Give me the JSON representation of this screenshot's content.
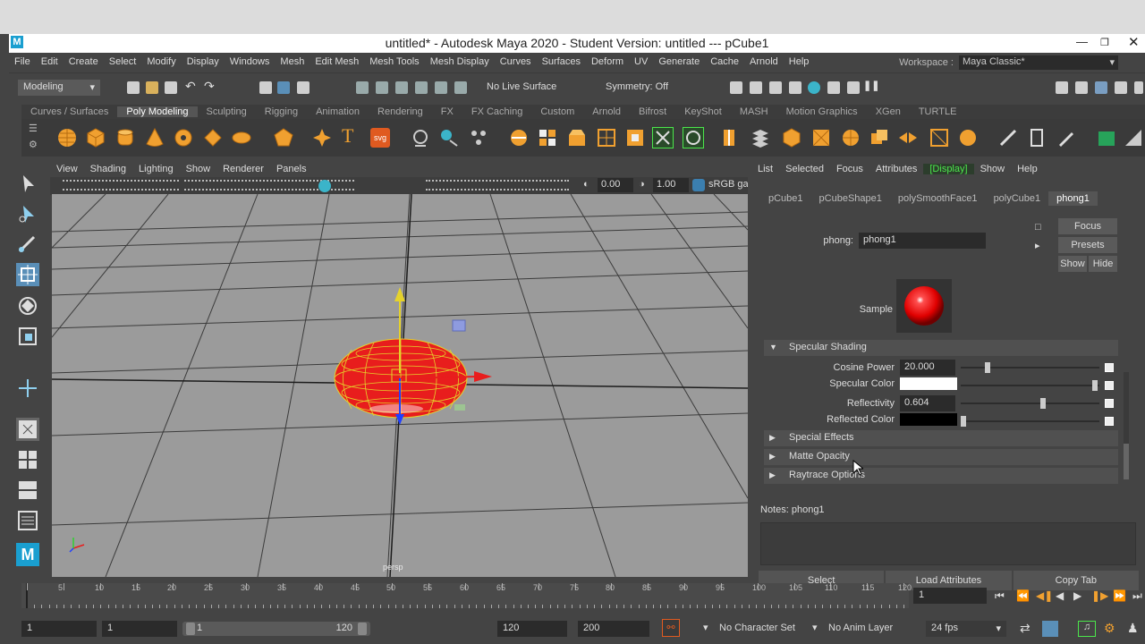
{
  "window": {
    "title": "untitled* - Autodesk Maya 2020 - Student Version: untitled   ---   pCube1",
    "logo": "M"
  },
  "menu": [
    "File",
    "Edit",
    "Create",
    "Select",
    "Modify",
    "Display",
    "Windows",
    "Mesh",
    "Edit Mesh",
    "Mesh Tools",
    "Mesh Display",
    "Curves",
    "Surfaces",
    "Deform",
    "UV",
    "Generate",
    "Cache",
    "Arnold",
    "Help"
  ],
  "workspace": {
    "label": "Workspace :",
    "value": "Maya Classic*"
  },
  "status": {
    "mode": "Modeling",
    "live_surface": "No Live Surface",
    "symmetry": "Symmetry: Off"
  },
  "shelf_tabs": [
    "Curves / Surfaces",
    "Poly Modeling",
    "Sculpting",
    "Rigging",
    "Animation",
    "Rendering",
    "FX",
    "FX Caching",
    "Custom",
    "Arnold",
    "Bifrost",
    "KeyShot",
    "MASH",
    "Motion Graphics",
    "XGen",
    "TURTLE"
  ],
  "shelf_active": "Poly Modeling",
  "viewport": {
    "menu": [
      "View",
      "Shading",
      "Lighting",
      "Show",
      "Renderer",
      "Panels"
    ],
    "exposure": "0.00",
    "gamma": "1.00",
    "colorspace": "sRGB gamma",
    "camera_label": "persp"
  },
  "attribute_editor": {
    "menu": [
      "List",
      "Selected",
      "Focus",
      "Attributes",
      "[Display]",
      "Show",
      "Help"
    ],
    "tabs": [
      "pCube1",
      "pCubeShape1",
      "polySmoothFace1",
      "polyCube1",
      "phong1"
    ],
    "active_tab": "phong1",
    "node_label": "phong:",
    "node_name": "phong1",
    "buttons": {
      "focus": "Focus",
      "presets": "Presets",
      "show": "Show",
      "hide": "Hide"
    },
    "sample_label": "Sample",
    "specular_section": "Specular Shading",
    "cosine_power": {
      "label": "Cosine Power",
      "value": "20.000"
    },
    "specular_color": {
      "label": "Specular Color",
      "color": "#ffffff"
    },
    "reflectivity": {
      "label": "Reflectivity",
      "value": "0.604"
    },
    "reflected_color": {
      "label": "Reflected Color",
      "color": "#000000"
    },
    "collapsed_sections": [
      "Special Effects",
      "Matte Opacity",
      "Raytrace Options"
    ],
    "notes_label": "Notes:  phong1",
    "bottom_buttons": [
      "Select",
      "Load Attributes",
      "Copy Tab"
    ]
  },
  "timeline": {
    "ticks": [
      "1",
      "5",
      "10",
      "15",
      "20",
      "25",
      "30",
      "35",
      "40",
      "45",
      "50",
      "55",
      "60",
      "65",
      "70",
      "75",
      "80",
      "85",
      "90",
      "95",
      "100",
      "105",
      "110",
      "115",
      "120"
    ],
    "current_frame": "1"
  },
  "range": {
    "start": "1",
    "anim_start": "1",
    "slider_start": "1",
    "slider_end": "120",
    "end": "120",
    "anim_end": "200",
    "character_set": "No Character Set",
    "anim_layer": "No Anim Layer",
    "fps": "24 fps"
  }
}
